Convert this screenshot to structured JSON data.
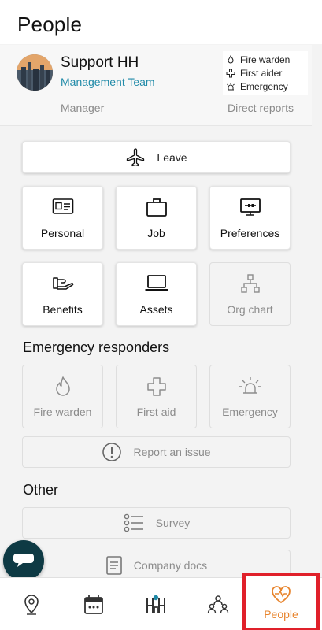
{
  "header": {
    "title": "People"
  },
  "profile": {
    "name": "Support HH",
    "team": "Management Team",
    "roles": [
      {
        "label": "Fire warden",
        "icon": "flame-icon"
      },
      {
        "label": "First aider",
        "icon": "plus-icon"
      },
      {
        "label": "Emergency",
        "icon": "siren-icon"
      }
    ],
    "manager_label": "Manager",
    "reports_label": "Direct reports"
  },
  "actions": {
    "leave": "Leave",
    "personal": "Personal",
    "job": "Job",
    "preferences": "Preferences",
    "benefits": "Benefits",
    "assets": "Assets",
    "org_chart": "Org chart"
  },
  "emergency": {
    "title": "Emergency responders",
    "fire_warden": "Fire warden",
    "first_aid": "First aid",
    "emergency": "Emergency",
    "report_issue": "Report an issue"
  },
  "other": {
    "title": "Other",
    "survey": "Survey",
    "company_docs": "Company docs"
  },
  "nav": {
    "items": [
      "location-pin-icon",
      "calendar-icon",
      "hr-logo-icon",
      "team-icon",
      "heart-icon"
    ],
    "people_label": "People",
    "active_color": "#e8852e",
    "highlight_color": "#e0202a"
  }
}
